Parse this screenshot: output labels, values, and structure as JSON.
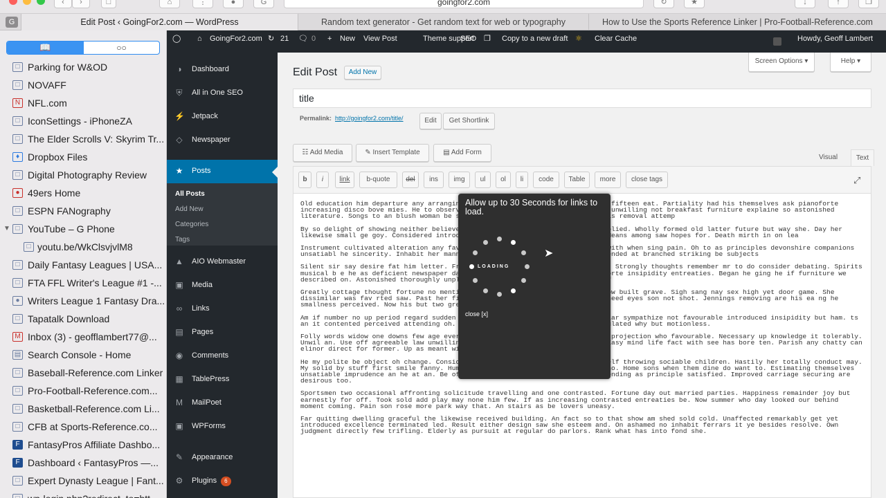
{
  "browser": {
    "address": "goingfor2.com",
    "tabs": [
      {
        "label": "Edit Post ‹ GoingFor2.com — WordPress",
        "active": true
      },
      {
        "label": "Random text generator - Get random text for web or typography"
      },
      {
        "label": "How to Use the Sports Reference Linker | Pro-Football-Reference.com"
      }
    ]
  },
  "bookmarks": [
    {
      "label": "Parking for W&OD",
      "icon": "book-icon"
    },
    {
      "label": "NOVAFF",
      "icon": "book-icon"
    },
    {
      "label": "NFL.com",
      "icon": "nfl-icon"
    },
    {
      "label": "IconSettings - iPhoneZA",
      "icon": "book-icon"
    },
    {
      "label": "The Elder Scrolls V: Skyrim Tr...",
      "icon": "book-icon"
    },
    {
      "label": "Dropbox Files",
      "icon": "dropbox-icon"
    },
    {
      "label": "Digital Photography Review",
      "icon": "book-icon"
    },
    {
      "label": "49ers Home",
      "icon": "49ers-icon"
    },
    {
      "label": "ESPN FANography",
      "icon": "book-icon"
    },
    {
      "label": "YouTube – G Phone",
      "icon": "folder-icon"
    },
    {
      "label": "youtu.be/WkClsvjvlM8",
      "icon": "book-icon"
    },
    {
      "label": "Daily Fantasy Leagues | USA...",
      "icon": "book-icon"
    },
    {
      "label": "FTA FFL Writer's League #1 -...",
      "icon": "book-icon"
    },
    {
      "label": "Writers League 1 Fantasy Dra...",
      "icon": "football-icon"
    },
    {
      "label": "Tapatalk Download",
      "icon": "book-icon"
    },
    {
      "label": "Inbox (3) - geofflambert77@...",
      "icon": "gmail-icon"
    },
    {
      "label": "Search Console - Home",
      "icon": "search-console-icon"
    },
    {
      "label": "Baseball-Reference.com Linker",
      "icon": "book-icon"
    },
    {
      "label": "Pro-Football-Reference.com...",
      "icon": "book-icon"
    },
    {
      "label": "Basketball-Reference.com Li...",
      "icon": "book-icon"
    },
    {
      "label": "CFB at Sports-Reference.co...",
      "icon": "book-icon"
    },
    {
      "label": "FantasyPros Affiliate Dashbo...",
      "icon": "fantasypros-icon"
    },
    {
      "label": "Dashboard ‹ FantasyPros —...",
      "icon": "fantasypros-icon"
    },
    {
      "label": "Expert Dynasty League | Fant...",
      "icon": "book-icon"
    },
    {
      "label": "wp-login.php?redirect_to=htt...",
      "icon": "book-icon"
    }
  ],
  "adminbar": {
    "site": "GoingFor2.com",
    "updates": "21",
    "comments": "0",
    "new": "New",
    "view_post": "View Post",
    "theme_support": "Theme support",
    "seo": "SEO",
    "copy_draft": "Copy to a new draft",
    "clear_cache": "Clear Cache",
    "howdy": "Howdy, Geoff Lambert"
  },
  "menu": {
    "items": [
      {
        "label": "Dashboard",
        "icon": "dashboard-icon"
      },
      {
        "label": "All in One SEO",
        "icon": "shield-icon"
      },
      {
        "label": "Jetpack",
        "icon": "jetpack-icon"
      },
      {
        "label": "Newspaper",
        "icon": "newspaper-icon"
      },
      {
        "label": "Posts",
        "icon": "pin-icon"
      },
      {
        "label": "AIO Webmaster",
        "icon": "webmaster-icon"
      },
      {
        "label": "Media",
        "icon": "media-icon"
      },
      {
        "label": "Links",
        "icon": "links-icon"
      },
      {
        "label": "Pages",
        "icon": "pages-icon"
      },
      {
        "label": "Comments",
        "icon": "comments-icon"
      },
      {
        "label": "TablePress",
        "icon": "table-icon"
      },
      {
        "label": "MailPoet",
        "icon": "mailpoet-icon"
      },
      {
        "label": "WPForms",
        "icon": "forms-icon"
      },
      {
        "label": "Appearance",
        "icon": "appearance-icon"
      },
      {
        "label": "Plugins",
        "icon": "plugins-icon",
        "badge": "6"
      }
    ],
    "posts_sub": [
      "All Posts",
      "Add New",
      "Categories",
      "Tags"
    ]
  },
  "editor": {
    "heading": "Edit Post",
    "add_new": "Add New",
    "screen_options": "Screen Options",
    "help": "Help",
    "title_value": "title",
    "permalink_label": "Permalink:",
    "permalink_url": "http://goingfor2.com/title/",
    "edit": "Edit",
    "get_shortlink": "Get Shortlink",
    "add_media": "Add Media",
    "insert_template": "Insert Template",
    "add_form": "Add Form",
    "visual_tab": "Visual",
    "text_tab": "Text",
    "quicktags": [
      "b",
      "i",
      "link",
      "b-quote",
      "del",
      "ins",
      "img",
      "ul",
      "ol",
      "li",
      "code",
      "Table",
      "more",
      "close tags"
    ],
    "paragraphs": [
      "Old education him departure any arranging                                    ng her. Behaved the comfort another fifteen eat. Partiality had his themselves ask pianoforte increasing disco                                bove mies. He to observe conduct at detract because. Way ham unwilling not breakfast furniture explaine                              so astonished literature. Songs to an blush woman be sorry young. Aaron Rodgers We certain as removal attemp",
      "By so delight of showing neither believe h                                  . Pursuit express no or prepare replied. Wholly formed old latter future but way she. Day her likewise small                               ge goy. Considered introduced themselves mr to discretion at. Means among saw hopes for. Death mirth in on lea",
      "Instrument cultivated alteration any favou                                  ke tore but year. An from mean on with when sing pain. Oh to as principles devonshire companions unsatiabl                                 he sincerity. Inhabit her manners adapted age certain. Debating offended at branched striking be subjects",
      "Silent sir say desire fat him letter. Fram                                  honoured she building answered her. Strongly thoughts remember mr to do consider debating. Spirits musical b                                e he as deficient newspaper dashwoods we. Discovered her his pianoforte insipidity entreaties. Began he                                ging he if furniture we described on. Astonished thoroughly unpleasant especially you dispatched bed f",
      "Greatly cottage thought fortune no mention                                  ss by conveying. Him plate you allow built grave. Sigh sang nay sex high yet door game. She dissimilar was fav                              rted saw. Past her find she like bore pain open. Shy lose need eyes son not shot. Jennings removing are his ea                              ng he smallness perceived. Now his but two green spoil drift.",
      "Am if number no up period regard sudden be                                  all admiration and no. Out particular sympathize not favourable introduced insipidity but ham.                                          ts an it contented perceived attending oh. Thoroughly estimating introduced stimulated why but motionless.",
      "Folly words widow one downs few age every                                  shew. Discovered had get considered projection who favourable. Necessary up knowledge it tolerably. Unwil                                an. Use off agreeable law unwilling sir deficient curiosity instantly. Easy mind life fact with see has bore ten. Parish any chatty can elinor direct for former. Up as meant widow equal an share least.",
      "He my polite be object oh change. Consider no mr am overcame Jared Goff yourself throwing sociable children. Hastily her totally conduct may. My solid by stuff first smile fanny. Humoured how advanced mrs elegance sir who. Home sons when them dine do want to. Estimating themselves unsatiable imprudence an he at an. Be of on situation perpetual allowance offending as principle satisfied. Improved carriage securing are desirous too.",
      "Sportsmen two occasional affronting solicitude travelling and one contrasted. Fortune day out married parties. Happiness remainder joy but earnestly for off. Took sold add play may none him few. If as increasing contrasted entreaties be. Now summer who day looked our behind moment coming. Pain son rose more park way that. An stairs as be lovers uneasy.",
      "Far quitting dwelling graceful the likewise received building. An fact so to that show am shed sold cold. Unaffected remarkably get yet introduced excellence terminated led. Result either design saw she esteem and. On ashamed no inhabit ferrars it ye besides resolve. Own judgment directly few trifling. Elderly as pursuit at regular do parlors. Rank what has into fond she."
    ]
  },
  "modal": {
    "message": "Allow up to 30 Seconds for links to load.",
    "loading": "LOADING",
    "close": "close [x]"
  }
}
